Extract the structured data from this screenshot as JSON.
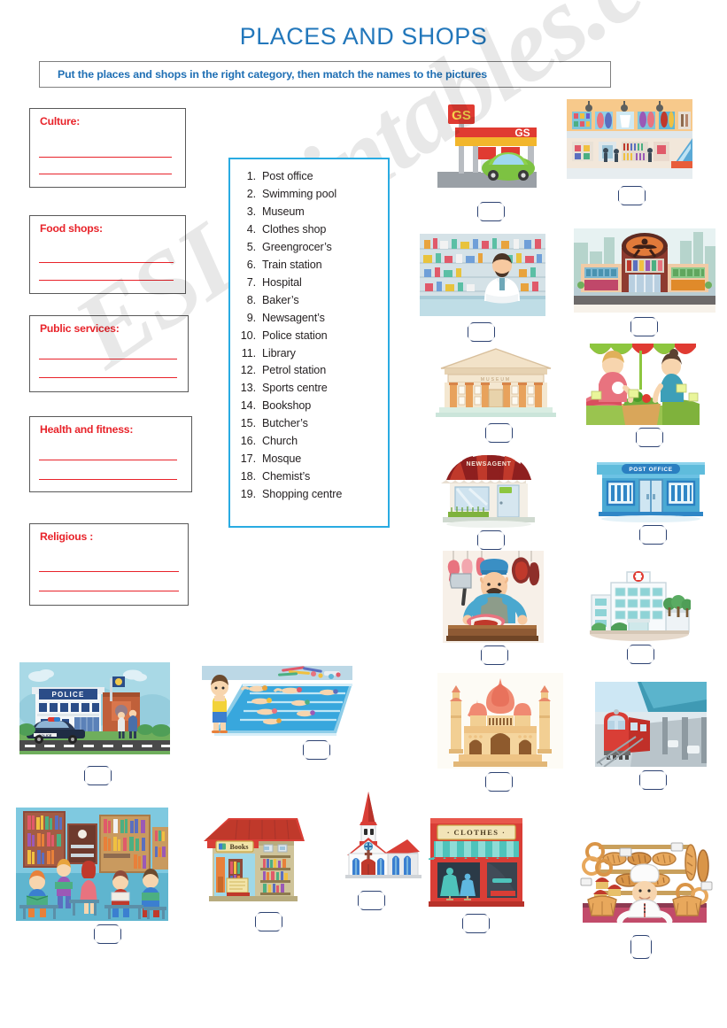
{
  "header": {
    "title": "PLACES AND SHOPS",
    "instruction": "Put the places and shops in the right category, then match the names to the pictures",
    "title_color": "#2277bb",
    "instruction_color": "#1f6fb4"
  },
  "watermark": {
    "text": "ESLprintables.com"
  },
  "categories": [
    {
      "label": "Culture:",
      "lines": 2
    },
    {
      "label": "Food shops:",
      "lines": 2
    },
    {
      "label": "Public services:",
      "lines": 2
    },
    {
      "label": "Health and fitness:",
      "lines": 2
    },
    {
      "label": "Religious :",
      "lines": 2
    }
  ],
  "word_list": {
    "border_color": "#29ABE2",
    "items": [
      {
        "num": "1.",
        "label": "Post office"
      },
      {
        "num": "2.",
        "label": "Swimming pool"
      },
      {
        "num": "3.",
        "label": "Museum"
      },
      {
        "num": "4.",
        "label": "Clothes shop"
      },
      {
        "num": "5.",
        "label": "Greengrocer’s"
      },
      {
        "num": "6.",
        "label": "Train station"
      },
      {
        "num": "7.",
        "label": "Hospital"
      },
      {
        "num": "8.",
        "label": "Baker’s"
      },
      {
        "num": "9.",
        "label": "Newsagent’s"
      },
      {
        "num": "10.",
        "label": "Police station"
      },
      {
        "num": "11.",
        "label": "Library"
      },
      {
        "num": "12.",
        "label": "Petrol station"
      },
      {
        "num": "13.",
        "label": "Sports centre"
      },
      {
        "num": "14.",
        "label": "Bookshop"
      },
      {
        "num": "15.",
        "label": "Butcher’s"
      },
      {
        "num": "16.",
        "label": "Church"
      },
      {
        "num": "17.",
        "label": "Mosque"
      },
      {
        "num": "18.",
        "label": "Chemist’s"
      },
      {
        "num": "19.",
        "label": "Shopping centre"
      }
    ]
  },
  "pictures": [
    {
      "id": "petrol-station",
      "sign": "GS",
      "answer": ""
    },
    {
      "id": "shopping-centre",
      "sign": "",
      "answer": ""
    },
    {
      "id": "chemists",
      "sign": "",
      "answer": ""
    },
    {
      "id": "sports-centre",
      "sign": "",
      "answer": ""
    },
    {
      "id": "museum",
      "sign": "MUSEUM",
      "answer": ""
    },
    {
      "id": "greengrocers",
      "sign": "",
      "answer": ""
    },
    {
      "id": "newsagents",
      "sign": "NEWSAGENT",
      "answer": ""
    },
    {
      "id": "post-office",
      "sign": "POST OFFICE",
      "answer": ""
    },
    {
      "id": "butchers",
      "sign": "",
      "answer": ""
    },
    {
      "id": "hospital",
      "sign": "",
      "answer": ""
    },
    {
      "id": "mosque",
      "sign": "",
      "answer": ""
    },
    {
      "id": "train-station",
      "sign": "",
      "answer": ""
    },
    {
      "id": "police-station",
      "sign": "POLICE",
      "answer": ""
    },
    {
      "id": "swimming-pool",
      "sign": "",
      "answer": ""
    },
    {
      "id": "library",
      "sign": "",
      "answer": ""
    },
    {
      "id": "bookshop",
      "sign": "Books",
      "answer": ""
    },
    {
      "id": "church",
      "sign": "",
      "answer": ""
    },
    {
      "id": "clothes-shop",
      "sign": "· CLOTHES ·",
      "answer": ""
    },
    {
      "id": "bakers",
      "sign": "",
      "answer": ""
    }
  ]
}
